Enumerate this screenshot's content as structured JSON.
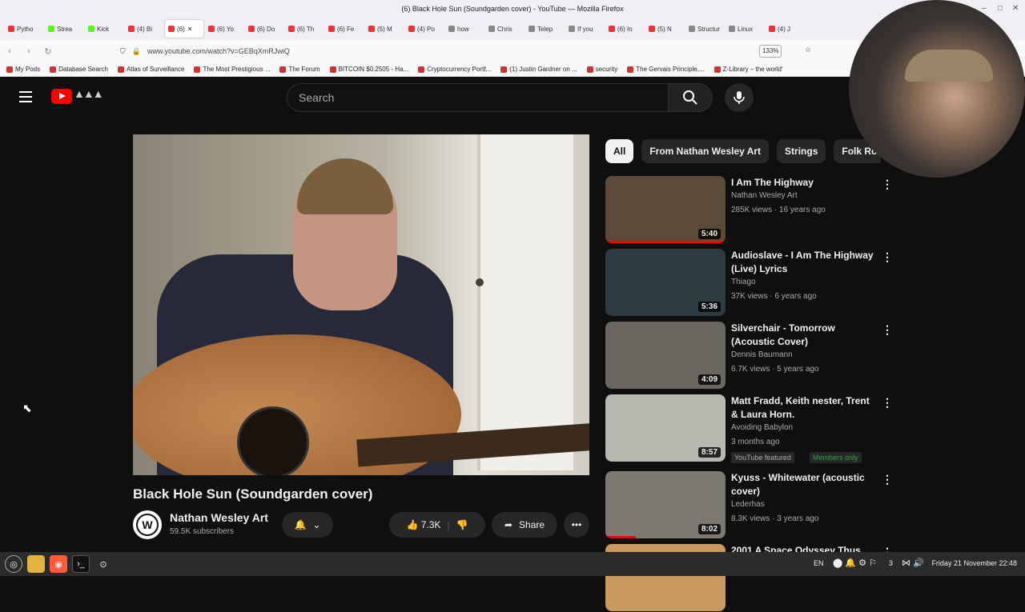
{
  "window": {
    "title": "(6) Black Hole Sun (Soundgarden cover) - YouTube — Mozilla Firefox",
    "controls": [
      "–",
      "□",
      "✕"
    ]
  },
  "tabs": [
    {
      "label": "Pytho",
      "icon": "youtube-icon"
    },
    {
      "label": "Strea",
      "icon": "kick-icon"
    },
    {
      "label": "Kick",
      "icon": "kick-icon"
    },
    {
      "label": "(4) Bi",
      "icon": "youtube-icon"
    },
    {
      "label": "(6)",
      "icon": "youtube-icon",
      "active": true
    },
    {
      "label": "(6) Yo",
      "icon": "youtube-icon"
    },
    {
      "label": "(6) Do",
      "icon": "youtube-icon"
    },
    {
      "label": "(6) Th",
      "icon": "youtube-icon"
    },
    {
      "label": "(6) Fe",
      "icon": "youtube-icon"
    },
    {
      "label": "(5) M",
      "icon": "youtube-icon"
    },
    {
      "label": "(4) Po",
      "icon": "youtube-icon"
    },
    {
      "label": "how",
      "icon": "generic-icon"
    },
    {
      "label": "Chris",
      "icon": "wikipedia-icon"
    },
    {
      "label": "Telep",
      "icon": "wikipedia-icon"
    },
    {
      "label": "If you",
      "icon": "generic-icon"
    },
    {
      "label": "(6) In",
      "icon": "youtube-icon"
    },
    {
      "label": "(5) N",
      "icon": "youtube-icon"
    },
    {
      "label": "Structur",
      "icon": "generic-icon"
    },
    {
      "label": "Linux",
      "icon": "generic-icon"
    },
    {
      "label": "(4) J",
      "icon": "youtube-icon"
    }
  ],
  "nav": {
    "url": "www.youtube.com/watch?v=GEBqXmRJwiQ",
    "zoom": "133%"
  },
  "bookmarks": [
    "My Pods",
    "Database Search",
    "Atlas of Surveillance",
    "The Most Prestigious ...",
    "The Forum",
    "BITCOIN $0.2505 - Ha...",
    "Cryptocurrency Portf...",
    "(1) Justin Gardner on ...",
    "security",
    "The Gervais Principle,...",
    "Z-Library – the world'"
  ],
  "youtube": {
    "search_placeholder": "Search",
    "video_title": "Black Hole Sun (Soundgarden cover)",
    "channel": "Nathan Wesley Art",
    "subscribers": "59.5K subscribers",
    "likes": "7.3K",
    "share_label": "Share",
    "chips": [
      "All",
      "From Nathan Wesley Art",
      "Strings",
      "Folk Rock"
    ],
    "recommendations": [
      {
        "title": "I Am The Highway",
        "channel": "Nathan Wesley Art",
        "meta": "285K views · 16 years ago",
        "duration": "5:40",
        "progress": 1.0,
        "thumb": "#5c4a38"
      },
      {
        "title": "Audioslave - I Am The Highway (Live) Lyrics",
        "channel": "Thiago",
        "meta": "37K views · 6 years ago",
        "duration": "5:36",
        "thumb": "#2d3a42"
      },
      {
        "title": "Silverchair - Tomorrow (Acoustic Cover)",
        "channel": "Dennis Baumann",
        "meta": "6.7K views · 5 years ago",
        "duration": "4:09",
        "thumb": "#6a6660"
      },
      {
        "title": "Matt Fradd, Keith nester, Trent & Laura Horn.",
        "channel": "Avoiding Babylon",
        "meta": "3 months ago",
        "duration": "8:57",
        "thumb": "#b8b8b0",
        "badges": [
          "YouTube featured",
          "Members only"
        ]
      },
      {
        "title": "Kyuss - Whitewater (acoustic cover)",
        "channel": "Lederhas",
        "meta": "8.3K views · 3 years ago",
        "duration": "8:02",
        "progress": 0.25,
        "thumb": "#7c7a70"
      },
      {
        "title": "2001 A Space Odyssey Thus",
        "thumb": "#c99a60"
      }
    ]
  },
  "taskbar": {
    "lang": "EN",
    "clock": "Friday 21 November 22:48",
    "indicator": "3"
  }
}
